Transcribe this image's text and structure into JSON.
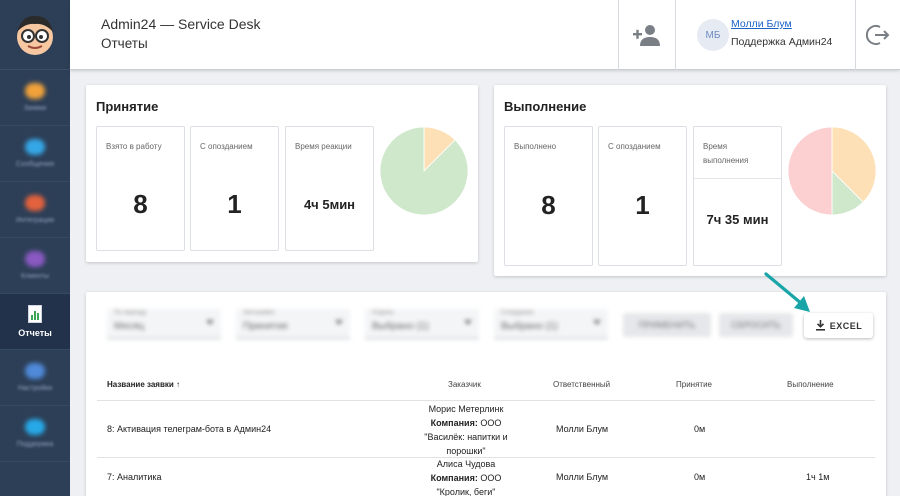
{
  "header": {
    "app_title": "Admin24 — Service Desk",
    "page_title": "Отчеты",
    "user": {
      "initials": "МБ",
      "name": "Молли Блум",
      "org": "Поддержка Админ24"
    }
  },
  "sidebar": {
    "items": [
      {
        "label": "Заявки",
        "color": "#f1a23a"
      },
      {
        "label": "Сообщения",
        "color": "#35a7e6"
      },
      {
        "label": "Интеграции",
        "color": "#e3623d"
      },
      {
        "label": "Клиенты",
        "color": "#8a59c2"
      },
      {
        "label": "Отчеты",
        "color": "#ffffff"
      },
      {
        "label": "Настройки",
        "color": "#4f8ad9"
      },
      {
        "label": "Поддержка",
        "color": "#27a9e8"
      }
    ],
    "active_index": 4
  },
  "acceptance": {
    "title": "Принятие",
    "stats": [
      {
        "label": "Взято в работу",
        "value": "8"
      },
      {
        "label": "С опозданием",
        "value": "1"
      },
      {
        "label": "Время реакции",
        "value": "4ч 5мин"
      }
    ],
    "pie_fractions": [
      0.125,
      0.875
    ],
    "pie_colors": [
      "#fde0b6",
      "#cfe8cb"
    ]
  },
  "completion": {
    "title": "Выполнение",
    "stats": [
      {
        "label": "Выполнено",
        "value": "8"
      },
      {
        "label": "С опозданием",
        "value": "1"
      },
      {
        "label": "Время выполнения",
        "value": "7ч 35 мин"
      }
    ],
    "pie_fractions": [
      0.375,
      0.125,
      0.5
    ],
    "pie_colors": [
      "#fde0b6",
      "#cfe8cb",
      "#fccfd1"
    ]
  },
  "filters": {
    "fields": [
      {
        "title": "По периоду",
        "value": "Месяц"
      },
      {
        "title": "Автозаявки",
        "value": "Принятие"
      },
      {
        "title": "Отделы",
        "value": "Выбрано (1)"
      },
      {
        "title": "Сотрудники",
        "value": "Выбрано (1)"
      }
    ],
    "apply_label": "ПРИМЕНИТЬ",
    "reset_label": "СБРОСИТЬ",
    "excel_label": "EXCEL"
  },
  "table": {
    "columns": [
      "Название заявки",
      "Заказчик",
      "Ответственный",
      "Принятие",
      "Выполнение"
    ],
    "sort_arrow": "↑",
    "rows": [
      {
        "name": "8: Активация телеграм-бота в Админ24",
        "customer": "Морис Метерлинк",
        "company_label": "Компания:",
        "company_line1": "ООО",
        "company_line2": "\"Василёк: напитки и",
        "company_line3": "порошки\"",
        "responsible": "Молли Блум",
        "acceptance": "0м",
        "completion": ""
      },
      {
        "name": "7: Аналитика",
        "customer": "Алиса Чудова",
        "company_label": "Компания:",
        "company_line1": "ООО",
        "company_line2": "\"Кролик, беги\"",
        "company_line3": "",
        "responsible": "Молли Блум",
        "acceptance": "0м",
        "completion": "1ч 1м"
      }
    ]
  }
}
